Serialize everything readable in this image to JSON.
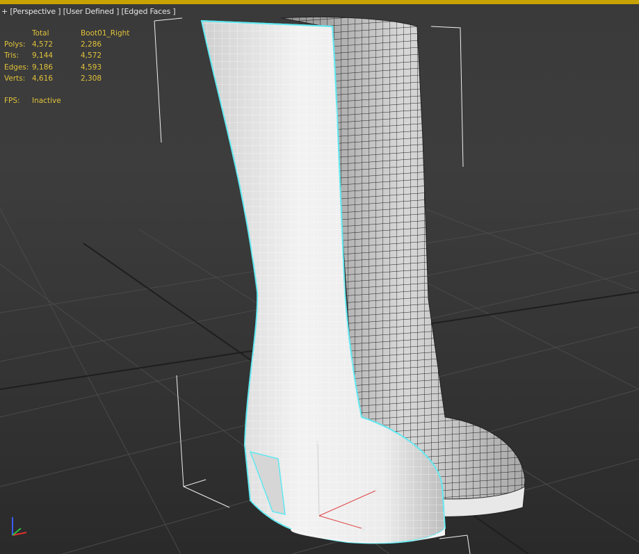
{
  "viewport": {
    "label_plus": "+",
    "label_view": "[Perspective ]",
    "label_camera": "[User Defined ]",
    "label_shading": "[Edged Faces ]"
  },
  "stats": {
    "header_total": "Total",
    "header_object": "Boot01_Right",
    "rows": [
      {
        "label": "Polys:",
        "total": "4,572",
        "object": "2,286"
      },
      {
        "label": "Tris:",
        "total": "9,144",
        "object": "4,572"
      },
      {
        "label": "Edges:",
        "total": "9,186",
        "object": "4,593"
      },
      {
        "label": "Verts:",
        "total": "4,616",
        "object": "2,308"
      }
    ],
    "fps_label": "FPS:",
    "fps_value": "Inactive"
  },
  "gizmo": {
    "z": "z",
    "y": "y",
    "x": "x"
  },
  "colors": {
    "stats_text": "#e0c23a",
    "viewport_bg": "#3b3b3b",
    "selection_outline": "#5fe8f0",
    "active_border": "#c8a200"
  }
}
